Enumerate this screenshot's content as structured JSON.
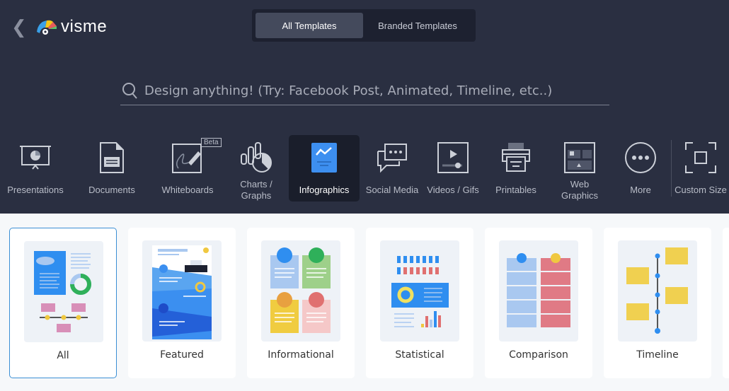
{
  "header": {
    "back_icon": "chevron-left-icon",
    "logo": "visme",
    "tabs": [
      {
        "label": "All Templates",
        "active": true
      },
      {
        "label": "Branded Templates",
        "active": false
      }
    ]
  },
  "search": {
    "placeholder": "Design anything! (Try: Facebook Post, Animated, Timeline, etc..)",
    "icon": "search-icon"
  },
  "categories": [
    {
      "label": "Presentations",
      "icon": "presentation-icon"
    },
    {
      "label": "Documents",
      "icon": "document-icon"
    },
    {
      "label": "Whiteboards",
      "icon": "whiteboard-icon",
      "badge": "Beta"
    },
    {
      "label": "Charts / Graphs",
      "icon": "chart-icon"
    },
    {
      "label": "Infographics",
      "icon": "infographic-icon",
      "active": true
    },
    {
      "label": "Social Media",
      "icon": "chat-bubbles-icon"
    },
    {
      "label": "Videos / Gifs",
      "icon": "video-icon"
    },
    {
      "label": "Printables",
      "icon": "printer-icon"
    },
    {
      "label": "Web Graphics",
      "icon": "web-graphic-icon"
    },
    {
      "label": "More",
      "icon": "more-icon"
    },
    {
      "label": "Custom Size",
      "icon": "custom-size-icon"
    }
  ],
  "cards": [
    {
      "label": "All",
      "active": true
    },
    {
      "label": "Featured"
    },
    {
      "label": "Informational"
    },
    {
      "label": "Statistical"
    },
    {
      "label": "Comparison"
    },
    {
      "label": "Timeline"
    }
  ],
  "colors": {
    "header_bg": "#2a2f41",
    "accent": "#3b8fd4",
    "active_icon": "#3d8ff0"
  }
}
